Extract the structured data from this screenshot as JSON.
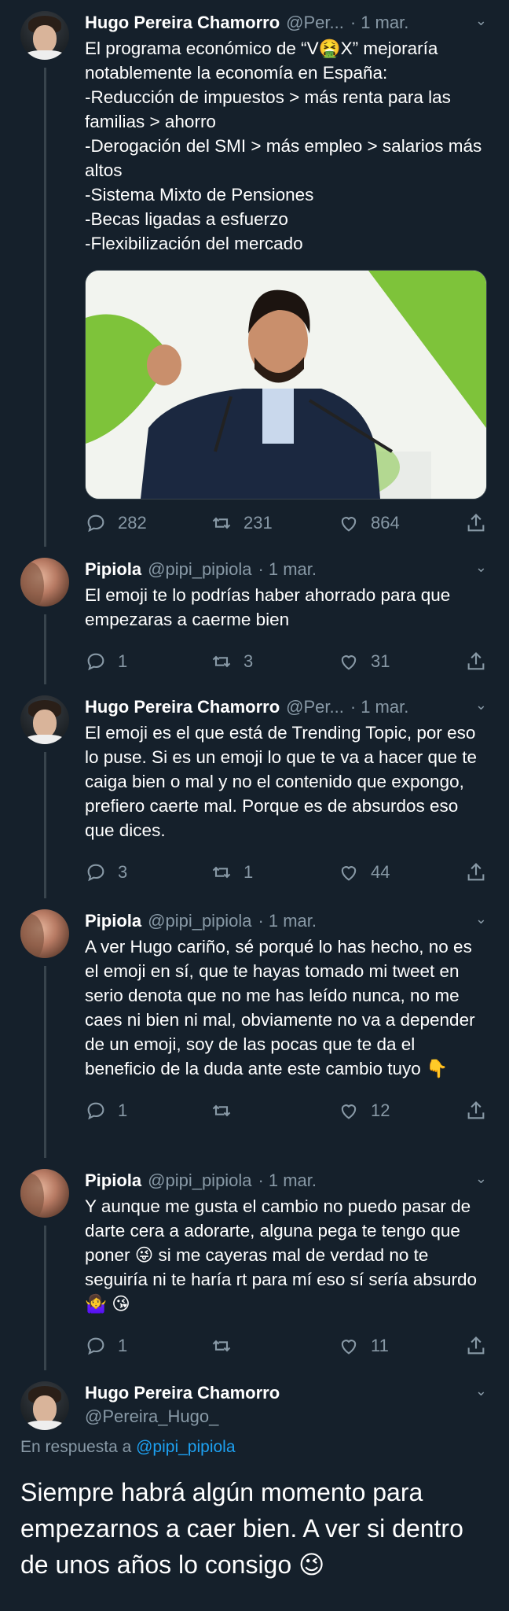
{
  "tweets": [
    {
      "name": "Hugo Pereira Chamorro",
      "handle": "@Per...",
      "date": "1 mar.",
      "text": "El programa económico de “V🤮X” mejoraría notablemente la economía en España:\n-Reducción de impuestos > más renta para las familias > ahorro\n-Derogación del SMI > más empleo > salarios más altos\n-Sistema Mixto de Pensiones\n-Becas ligadas a esfuerzo\n-Flexibilización del mercado",
      "replies": "282",
      "retweets": "231",
      "likes": "864"
    },
    {
      "name": "Pipiola",
      "handle": "@pipi_pipiola",
      "date": "1 mar.",
      "text": "El emoji te lo podrías haber ahorrado para que empezaras a caerme bien",
      "replies": "1",
      "retweets": "3",
      "likes": "31"
    },
    {
      "name": "Hugo Pereira Chamorro",
      "handle": "@Per...",
      "date": "1 mar.",
      "text": "El emoji es el que está de Trending Topic, por eso lo puse. Si es un emoji lo que te va a hacer que te caiga bien o mal y no el contenido que expongo, prefiero caerte mal. Porque es de absurdos eso que dices.",
      "replies": "3",
      "retweets": "1",
      "likes": "44"
    },
    {
      "name": "Pipiola",
      "handle": "@pipi_pipiola",
      "date": "1 mar.",
      "text": "A ver Hugo cariño, sé porqué lo has hecho, no es el emoji en sí, que te hayas tomado mi tweet en serio denota que no me has leído nunca, no me caes ni bien ni mal, obviamente no va a depender de un emoji, soy de las pocas que te da el beneficio de la duda ante este cambio tuyo 👇",
      "replies": "1",
      "retweets": "",
      "likes": "12"
    },
    {
      "name": "Pipiola",
      "handle": "@pipi_pipiola",
      "date": "1 mar.",
      "text": "Y aunque me gusta el cambio no puedo pasar de darte cera a adorarte, alguna pega te tengo que poner 😜 si me cayeras mal de verdad no te seguiría ni te haría rt para mí eso sí sería absurdo🤷‍♀️ 😘",
      "replies": "1",
      "retweets": "",
      "likes": "11"
    }
  ],
  "final": {
    "name": "Hugo Pereira Chamorro",
    "handle": "@Pereira_Hugo_",
    "reply_prefix": "En respuesta a",
    "reply_link": "@pipi_pipiola",
    "text": "Siempre habrá algún momento para empezarnos a caer bien. A ver si dentro de unos años lo consigo 😉"
  },
  "icons": {
    "reply": "reply-icon",
    "retweet": "retweet-icon",
    "like": "heart-icon",
    "share": "share-icon",
    "more": "chevron-down-icon"
  },
  "colors": {
    "background": "#15202b",
    "secondary_text": "#8899a6",
    "link": "#1da1f2",
    "thread_line": "#38444d"
  }
}
